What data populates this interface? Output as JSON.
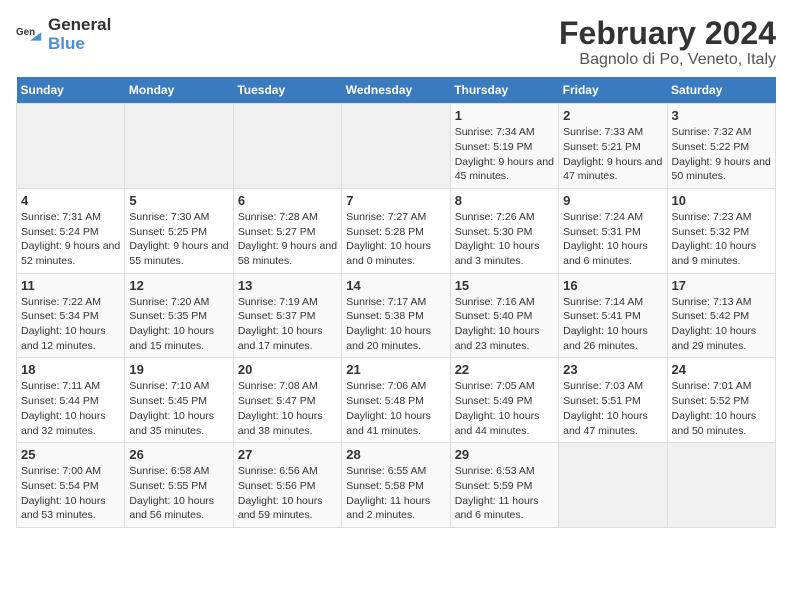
{
  "logo": {
    "line1": "General",
    "line2": "Blue"
  },
  "title": "February 2024",
  "subtitle": "Bagnolo di Po, Veneto, Italy",
  "days_of_week": [
    "Sunday",
    "Monday",
    "Tuesday",
    "Wednesday",
    "Thursday",
    "Friday",
    "Saturday"
  ],
  "weeks": [
    [
      {
        "day": "",
        "content": ""
      },
      {
        "day": "",
        "content": ""
      },
      {
        "day": "",
        "content": ""
      },
      {
        "day": "",
        "content": ""
      },
      {
        "day": "1",
        "content": "Sunrise: 7:34 AM\nSunset: 5:19 PM\nDaylight: 9 hours and 45 minutes."
      },
      {
        "day": "2",
        "content": "Sunrise: 7:33 AM\nSunset: 5:21 PM\nDaylight: 9 hours and 47 minutes."
      },
      {
        "day": "3",
        "content": "Sunrise: 7:32 AM\nSunset: 5:22 PM\nDaylight: 9 hours and 50 minutes."
      }
    ],
    [
      {
        "day": "4",
        "content": "Sunrise: 7:31 AM\nSunset: 5:24 PM\nDaylight: 9 hours and 52 minutes."
      },
      {
        "day": "5",
        "content": "Sunrise: 7:30 AM\nSunset: 5:25 PM\nDaylight: 9 hours and 55 minutes."
      },
      {
        "day": "6",
        "content": "Sunrise: 7:28 AM\nSunset: 5:27 PM\nDaylight: 9 hours and 58 minutes."
      },
      {
        "day": "7",
        "content": "Sunrise: 7:27 AM\nSunset: 5:28 PM\nDaylight: 10 hours and 0 minutes."
      },
      {
        "day": "8",
        "content": "Sunrise: 7:26 AM\nSunset: 5:30 PM\nDaylight: 10 hours and 3 minutes."
      },
      {
        "day": "9",
        "content": "Sunrise: 7:24 AM\nSunset: 5:31 PM\nDaylight: 10 hours and 6 minutes."
      },
      {
        "day": "10",
        "content": "Sunrise: 7:23 AM\nSunset: 5:32 PM\nDaylight: 10 hours and 9 minutes."
      }
    ],
    [
      {
        "day": "11",
        "content": "Sunrise: 7:22 AM\nSunset: 5:34 PM\nDaylight: 10 hours and 12 minutes."
      },
      {
        "day": "12",
        "content": "Sunrise: 7:20 AM\nSunset: 5:35 PM\nDaylight: 10 hours and 15 minutes."
      },
      {
        "day": "13",
        "content": "Sunrise: 7:19 AM\nSunset: 5:37 PM\nDaylight: 10 hours and 17 minutes."
      },
      {
        "day": "14",
        "content": "Sunrise: 7:17 AM\nSunset: 5:38 PM\nDaylight: 10 hours and 20 minutes."
      },
      {
        "day": "15",
        "content": "Sunrise: 7:16 AM\nSunset: 5:40 PM\nDaylight: 10 hours and 23 minutes."
      },
      {
        "day": "16",
        "content": "Sunrise: 7:14 AM\nSunset: 5:41 PM\nDaylight: 10 hours and 26 minutes."
      },
      {
        "day": "17",
        "content": "Sunrise: 7:13 AM\nSunset: 5:42 PM\nDaylight: 10 hours and 29 minutes."
      }
    ],
    [
      {
        "day": "18",
        "content": "Sunrise: 7:11 AM\nSunset: 5:44 PM\nDaylight: 10 hours and 32 minutes."
      },
      {
        "day": "19",
        "content": "Sunrise: 7:10 AM\nSunset: 5:45 PM\nDaylight: 10 hours and 35 minutes."
      },
      {
        "day": "20",
        "content": "Sunrise: 7:08 AM\nSunset: 5:47 PM\nDaylight: 10 hours and 38 minutes."
      },
      {
        "day": "21",
        "content": "Sunrise: 7:06 AM\nSunset: 5:48 PM\nDaylight: 10 hours and 41 minutes."
      },
      {
        "day": "22",
        "content": "Sunrise: 7:05 AM\nSunset: 5:49 PM\nDaylight: 10 hours and 44 minutes."
      },
      {
        "day": "23",
        "content": "Sunrise: 7:03 AM\nSunset: 5:51 PM\nDaylight: 10 hours and 47 minutes."
      },
      {
        "day": "24",
        "content": "Sunrise: 7:01 AM\nSunset: 5:52 PM\nDaylight: 10 hours and 50 minutes."
      }
    ],
    [
      {
        "day": "25",
        "content": "Sunrise: 7:00 AM\nSunset: 5:54 PM\nDaylight: 10 hours and 53 minutes."
      },
      {
        "day": "26",
        "content": "Sunrise: 6:58 AM\nSunset: 5:55 PM\nDaylight: 10 hours and 56 minutes."
      },
      {
        "day": "27",
        "content": "Sunrise: 6:56 AM\nSunset: 5:56 PM\nDaylight: 10 hours and 59 minutes."
      },
      {
        "day": "28",
        "content": "Sunrise: 6:55 AM\nSunset: 5:58 PM\nDaylight: 11 hours and 2 minutes."
      },
      {
        "day": "29",
        "content": "Sunrise: 6:53 AM\nSunset: 5:59 PM\nDaylight: 11 hours and 6 minutes."
      },
      {
        "day": "",
        "content": ""
      },
      {
        "day": "",
        "content": ""
      }
    ]
  ]
}
